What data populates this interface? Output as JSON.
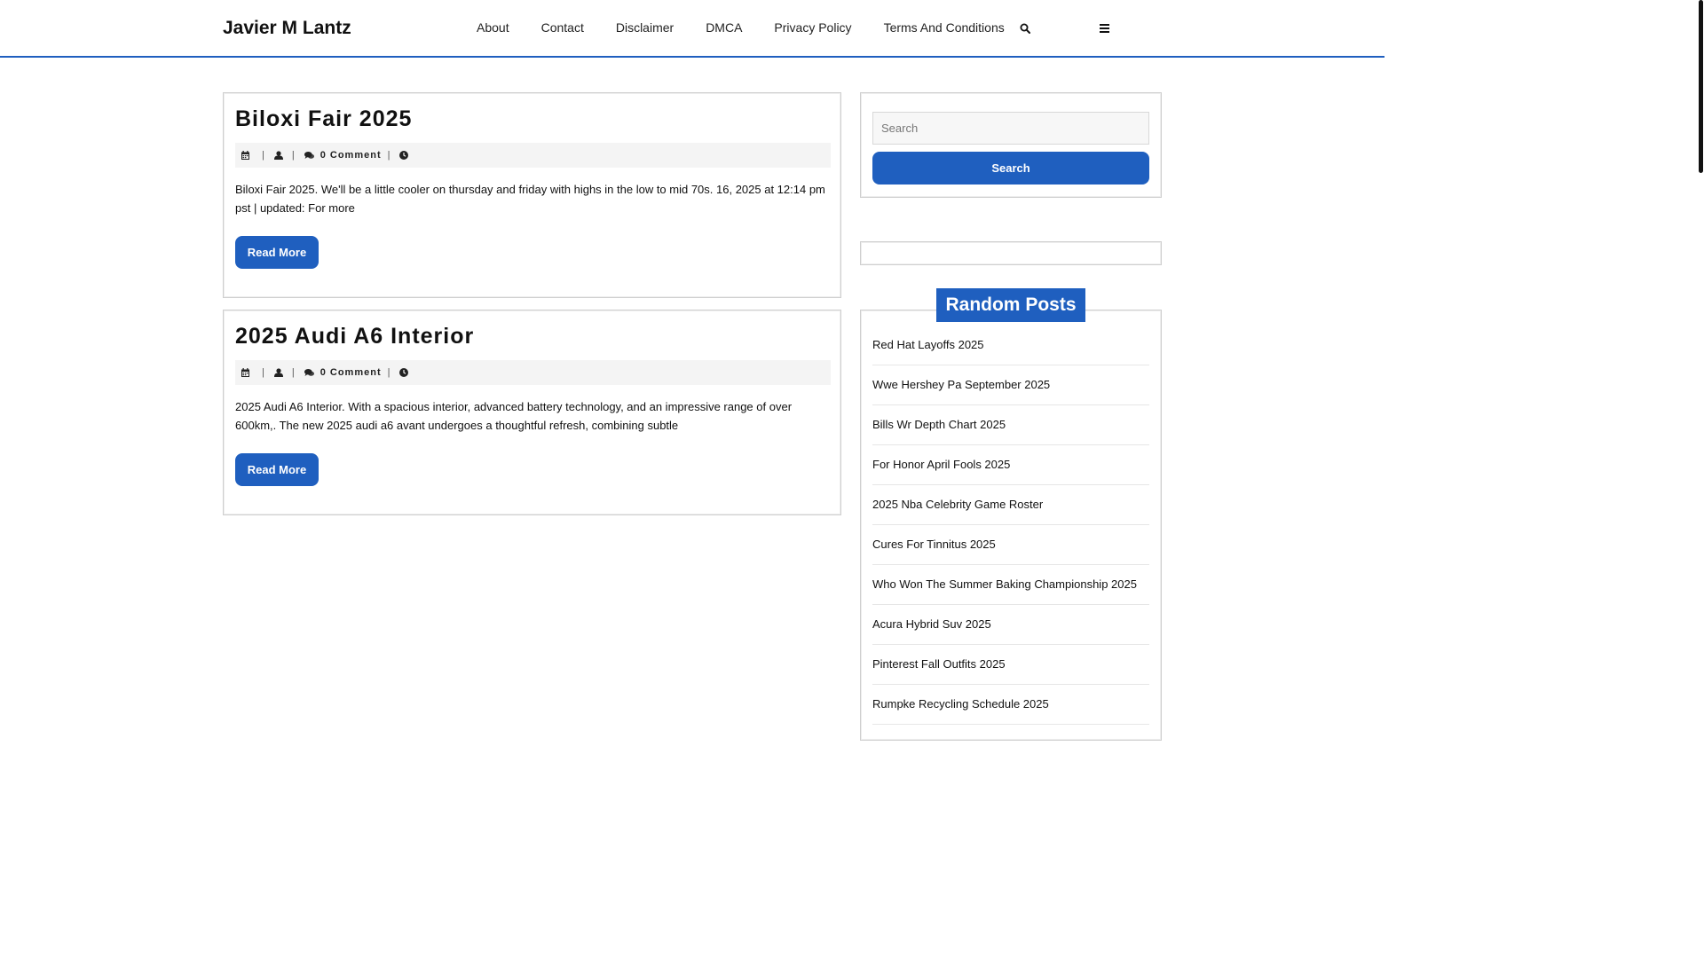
{
  "site": {
    "title": "Javier M Lantz"
  },
  "nav": {
    "items": [
      {
        "label": "About"
      },
      {
        "label": "Contact"
      },
      {
        "label": "Disclaimer"
      },
      {
        "label": "DMCA"
      },
      {
        "label": "Privacy Policy"
      },
      {
        "label": "Terms And Conditions"
      }
    ],
    "search_icon": "search-icon",
    "menu_icon": "hamburger-menu-icon"
  },
  "posts": [
    {
      "title": "Biloxi Fair 2025",
      "comments": "0 Comment",
      "excerpt": "Biloxi Fair 2025. We'll be a little cooler on thursday and friday with highs in the low to mid 70s. 16, 2025 at 12:14 pm pst | updated: For more",
      "read_more": "Read More"
    },
    {
      "title": "2025 Audi A6 Interior",
      "comments": "0 Comment",
      "excerpt": "2025 Audi A6 Interior. With a spacious interior, advanced battery technology, and an impressive range of over 600km,. The new 2025 audi a6 avant undergoes a thoughtful refresh, combining subtle",
      "read_more": "Read More"
    }
  ],
  "sidebar": {
    "search": {
      "placeholder": "Search",
      "button_label": "Search"
    },
    "random_posts": {
      "heading": "Random Posts",
      "items": [
        "Red Hat Layoffs 2025",
        "Wwe Hershey Pa September 2025",
        "Bills Wr Depth Chart 2025",
        "For Honor April Fools 2025",
        "2025 Nba Celebrity Game Roster",
        "Cures For Tinnitus 2025",
        "Who Won The Summer Baking Championship 2025",
        "Acura Hybrid Suv 2025",
        "Pinterest Fall Outfits 2025",
        "Rumpke Recycling Schedule 2025"
      ]
    }
  },
  "colors": {
    "accent": "#1f5fbf",
    "text": "#111111",
    "meta_background": "#f4f4f4"
  }
}
